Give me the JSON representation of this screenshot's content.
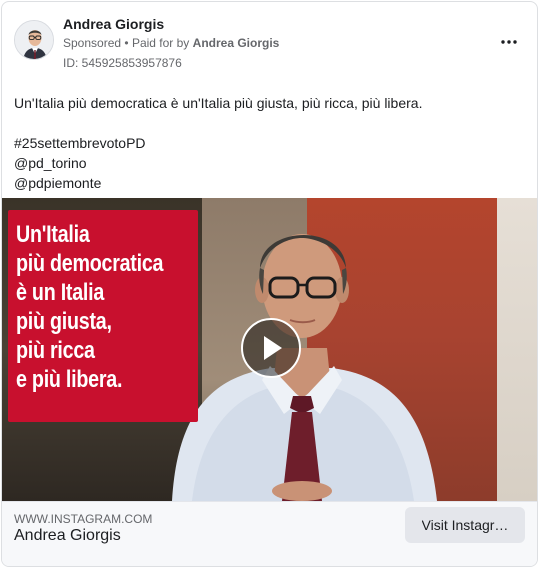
{
  "post": {
    "author_name": "Andrea Giorgis",
    "sponsored_label": "Sponsored",
    "paid_for_prefix": "Paid for by",
    "paid_for_name": "Andrea Giorgis",
    "ad_id": "ID: 545925853957876",
    "more_icon": "more-horizontal-icon"
  },
  "caption": {
    "lines": [
      "Un'Italia più democratica è un'Italia più giusta, più ricca, più libera.",
      "",
      "#25settembrevotoPD",
      "@pd_torino",
      "@pdpiemonte"
    ]
  },
  "media": {
    "overlay_lines": [
      "Un'Italia",
      "più democratica",
      "è un Italia",
      "più giusta,",
      "più ricca",
      "e più libera."
    ],
    "play_icon": "play-icon",
    "overlay_color": "#c8102e"
  },
  "footer": {
    "domain": "WWW.INSTAGRAM.COM",
    "title": "Andrea Giorgis",
    "cta_label": "Visit Instagr…"
  }
}
